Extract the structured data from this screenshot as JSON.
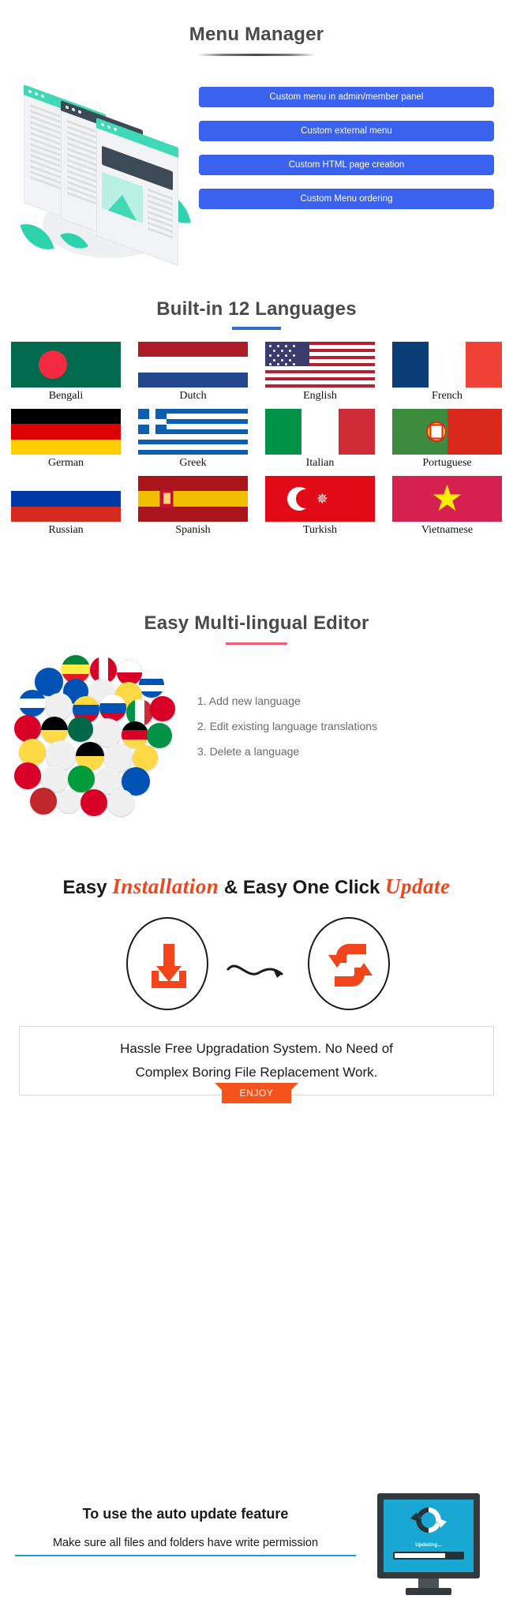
{
  "menu_manager": {
    "title": "Menu Manager",
    "features": [
      "Custom menu in admin/member panel",
      "Custom external menu",
      "Custom HTML page creation",
      "Custom Menu ordering"
    ],
    "button_color": "#3b62ef",
    "illustration_accent": "#2dd3ad"
  },
  "languages": {
    "title": "Built-in 12 Languages",
    "rule_color": "#2f6fd0",
    "items": [
      {
        "name": "Bengali",
        "flag": "bangladesh-flag"
      },
      {
        "name": "Dutch",
        "flag": "netherlands-flag"
      },
      {
        "name": "English",
        "flag": "usa-flag"
      },
      {
        "name": "French",
        "flag": "france-flag"
      },
      {
        "name": "German",
        "flag": "germany-flag"
      },
      {
        "name": "Greek",
        "flag": "greece-flag"
      },
      {
        "name": "Italian",
        "flag": "italy-flag"
      },
      {
        "name": "Portuguese",
        "flag": "portugal-flag"
      },
      {
        "name": "Russian",
        "flag": "russia-flag"
      },
      {
        "name": "Spanish",
        "flag": "spain-flag"
      },
      {
        "name": "Turkish",
        "flag": "turkey-flag"
      },
      {
        "name": "Vietnamese",
        "flag": "vietnam-flag"
      }
    ]
  },
  "editor": {
    "title": "Easy Multi-lingual Editor",
    "rule_color": "#f15b73",
    "items": [
      "1. Add new language",
      "2. Edit existing language translations",
      "3. Delete a language"
    ]
  },
  "install": {
    "heading_part1": "Easy ",
    "heading_script1": "Installation",
    "heading_part2": " & Easy One Click ",
    "heading_script2": "Update",
    "accent_color": "#f4441c",
    "box_line1": "Hassle Free Upgradation System. No Need of",
    "box_line2": "Complex Boring File Replacement Work.",
    "enjoy_label": "ENJOY"
  },
  "footer": {
    "headline": "To use the auto update feature",
    "subline": "Make sure all files and folders have write permission",
    "rule_color": "#1b9dd9",
    "monitor_label": "Updating...",
    "monitor_screen_color": "#19a8d4"
  }
}
